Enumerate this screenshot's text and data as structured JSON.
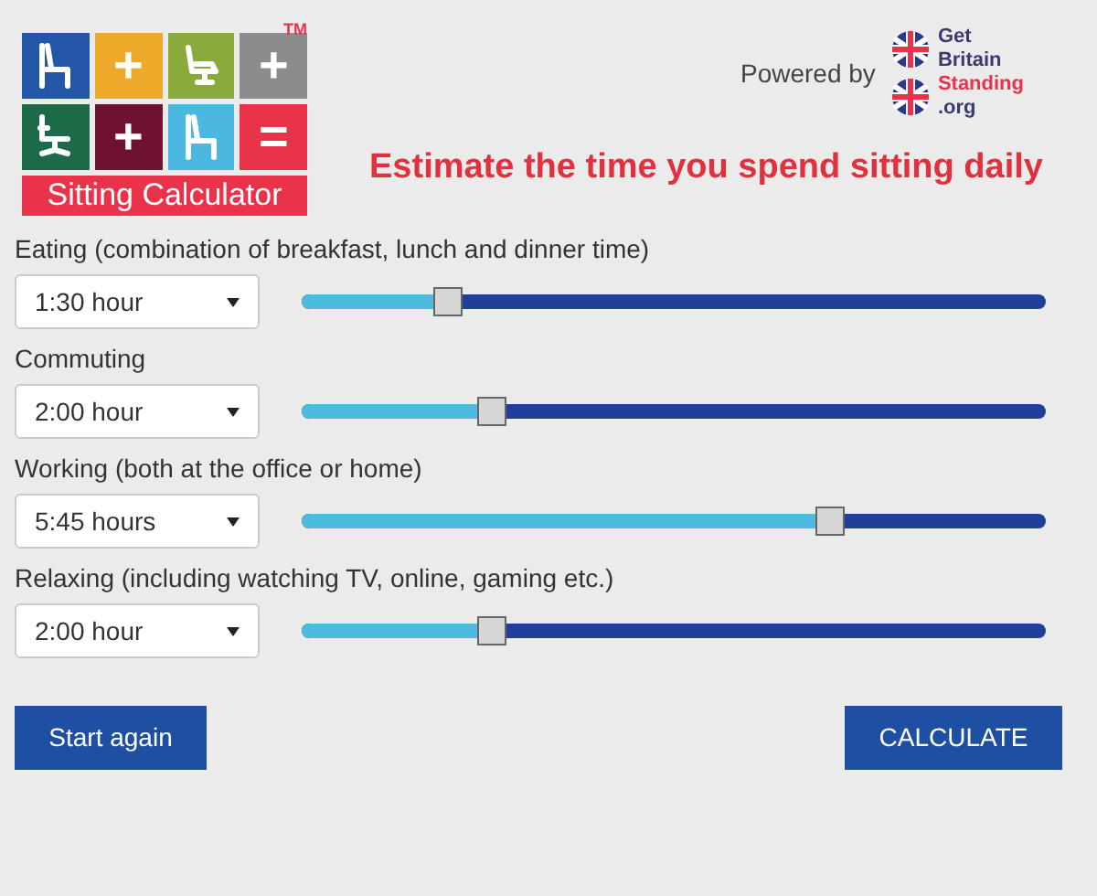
{
  "logo": {
    "tiles": [
      {
        "kind": "chair",
        "color": "#2356a6"
      },
      {
        "kind": "symbol",
        "text": "+",
        "color": "#eeaa2a"
      },
      {
        "kind": "recliner",
        "color": "#8aaa3c"
      },
      {
        "kind": "symbol",
        "text": "+",
        "color": "#8c8c8c"
      },
      {
        "kind": "office-chair",
        "color": "#1c6a48"
      },
      {
        "kind": "symbol",
        "text": "+",
        "color": "#6e1230"
      },
      {
        "kind": "chair",
        "color": "#4ab8e0"
      },
      {
        "kind": "symbol",
        "text": "=",
        "color": "#e8334a"
      }
    ],
    "trademark": "TM",
    "banner": "Sitting Calculator"
  },
  "powered_by": {
    "label": "Powered by",
    "brand": [
      "Get",
      "Britain",
      "Standing",
      ".org"
    ]
  },
  "heading": "Estimate the time you spend sitting daily",
  "activities": [
    {
      "label": "Eating (combination of breakfast, lunch and dinner time)",
      "value": "1:30 hour",
      "level": 0.197
    },
    {
      "label": "Commuting",
      "value": "2:00 hour",
      "level": 0.256
    },
    {
      "label": "Working (both at the office or home)",
      "value": "5:45 hours",
      "level": 0.71
    },
    {
      "label": "Relaxing (including watching TV, online, gaming etc.)",
      "value": "2:00 hour",
      "level": 0.256
    }
  ],
  "buttons": {
    "reset": "Start again",
    "submit": "CALCULATE"
  }
}
